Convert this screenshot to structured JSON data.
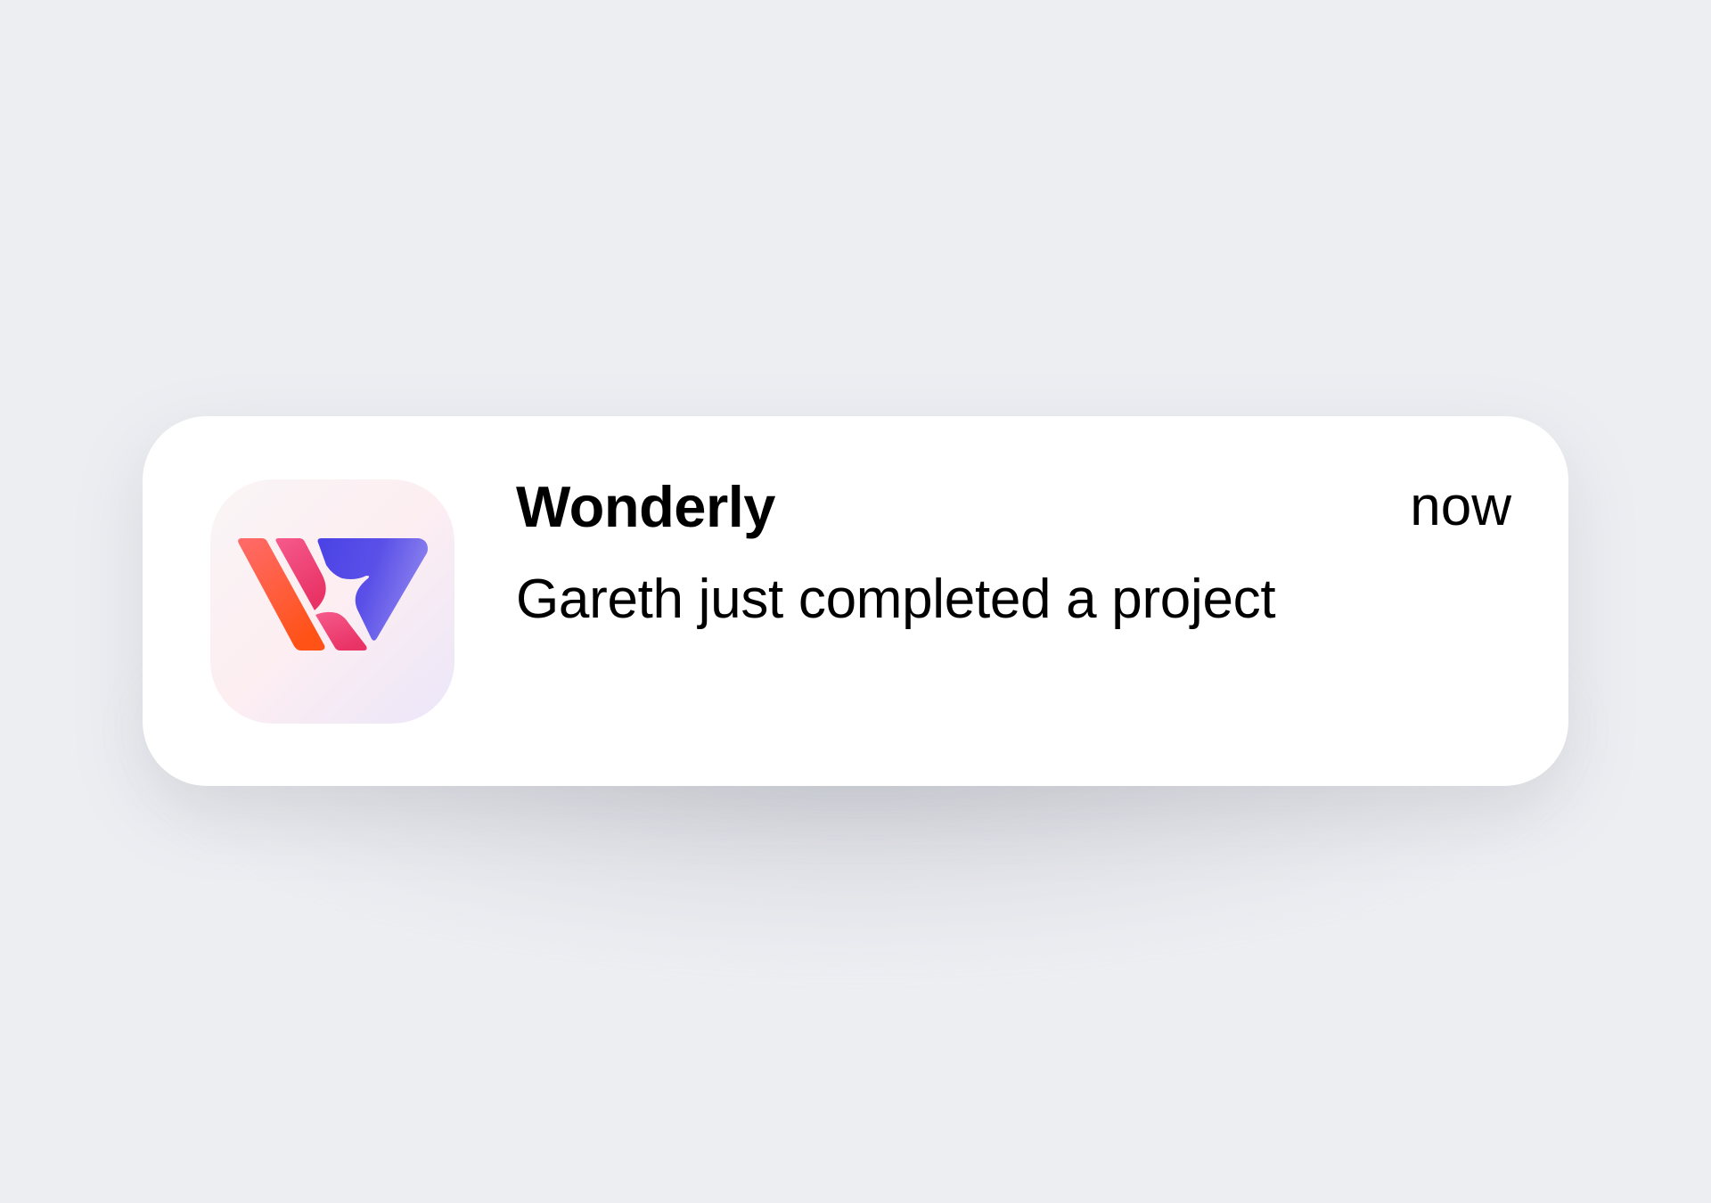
{
  "notification": {
    "app_name": "Wonderly",
    "timestamp": "now",
    "message": "Gareth just completed a project",
    "icon": "wonderly-logo-icon"
  },
  "colors": {
    "background": "#edeef2",
    "card": "#ffffff",
    "logo_orange": "#ff5a1f",
    "logo_pink": "#ee3d75",
    "logo_indigo": "#5147e5"
  }
}
